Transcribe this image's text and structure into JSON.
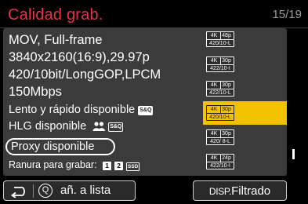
{
  "header": {
    "title": "Calidad grab.",
    "page_indicator": "15/19"
  },
  "info": {
    "format": "MOV, Full-frame",
    "resolution": "3840x2160(16:9),29.97p",
    "codec": "420/10bit/LongGOP,LPCM",
    "bitrate": "150Mbps",
    "slow_quick": "Lento y rápido disponible",
    "slow_quick_icon": "S&Q",
    "hlg": "HLG disponible",
    "hlg_icon": "S&Q",
    "proxy": "Proxy disponible",
    "slot_label": "Ranura para grabar:",
    "slot1": "1",
    "slot2": "2",
    "slot_ssd": "SSD"
  },
  "quality_list": {
    "items": [
      {
        "res": "4K",
        "fps": "48p",
        "codec": "420/10-L",
        "selected": false
      },
      {
        "res": "4K",
        "fps": "30p",
        "codec": "422/10-I",
        "selected": false
      },
      {
        "res": "4K",
        "fps": "30p",
        "codec": "422/10-L",
        "selected": false
      },
      {
        "res": "4K",
        "fps": "30p",
        "codec": "420/10-L",
        "selected": true
      },
      {
        "res": "4K",
        "fps": "30p",
        "codec": "420/ 8-L",
        "selected": false
      },
      {
        "res": "4K",
        "fps": "24p",
        "codec": "422/10-I",
        "selected": false
      }
    ],
    "selected_color": "#f2c200"
  },
  "footer": {
    "back_icon": "return-arrow-icon",
    "q_icon": "Q",
    "add_to_list": "añ. a lista",
    "disp_prefix": "DISP.",
    "filter": "Filtrado"
  },
  "colors": {
    "title": "#e8304a",
    "panel": "#3b3b3b",
    "selected": "#f2c200"
  }
}
